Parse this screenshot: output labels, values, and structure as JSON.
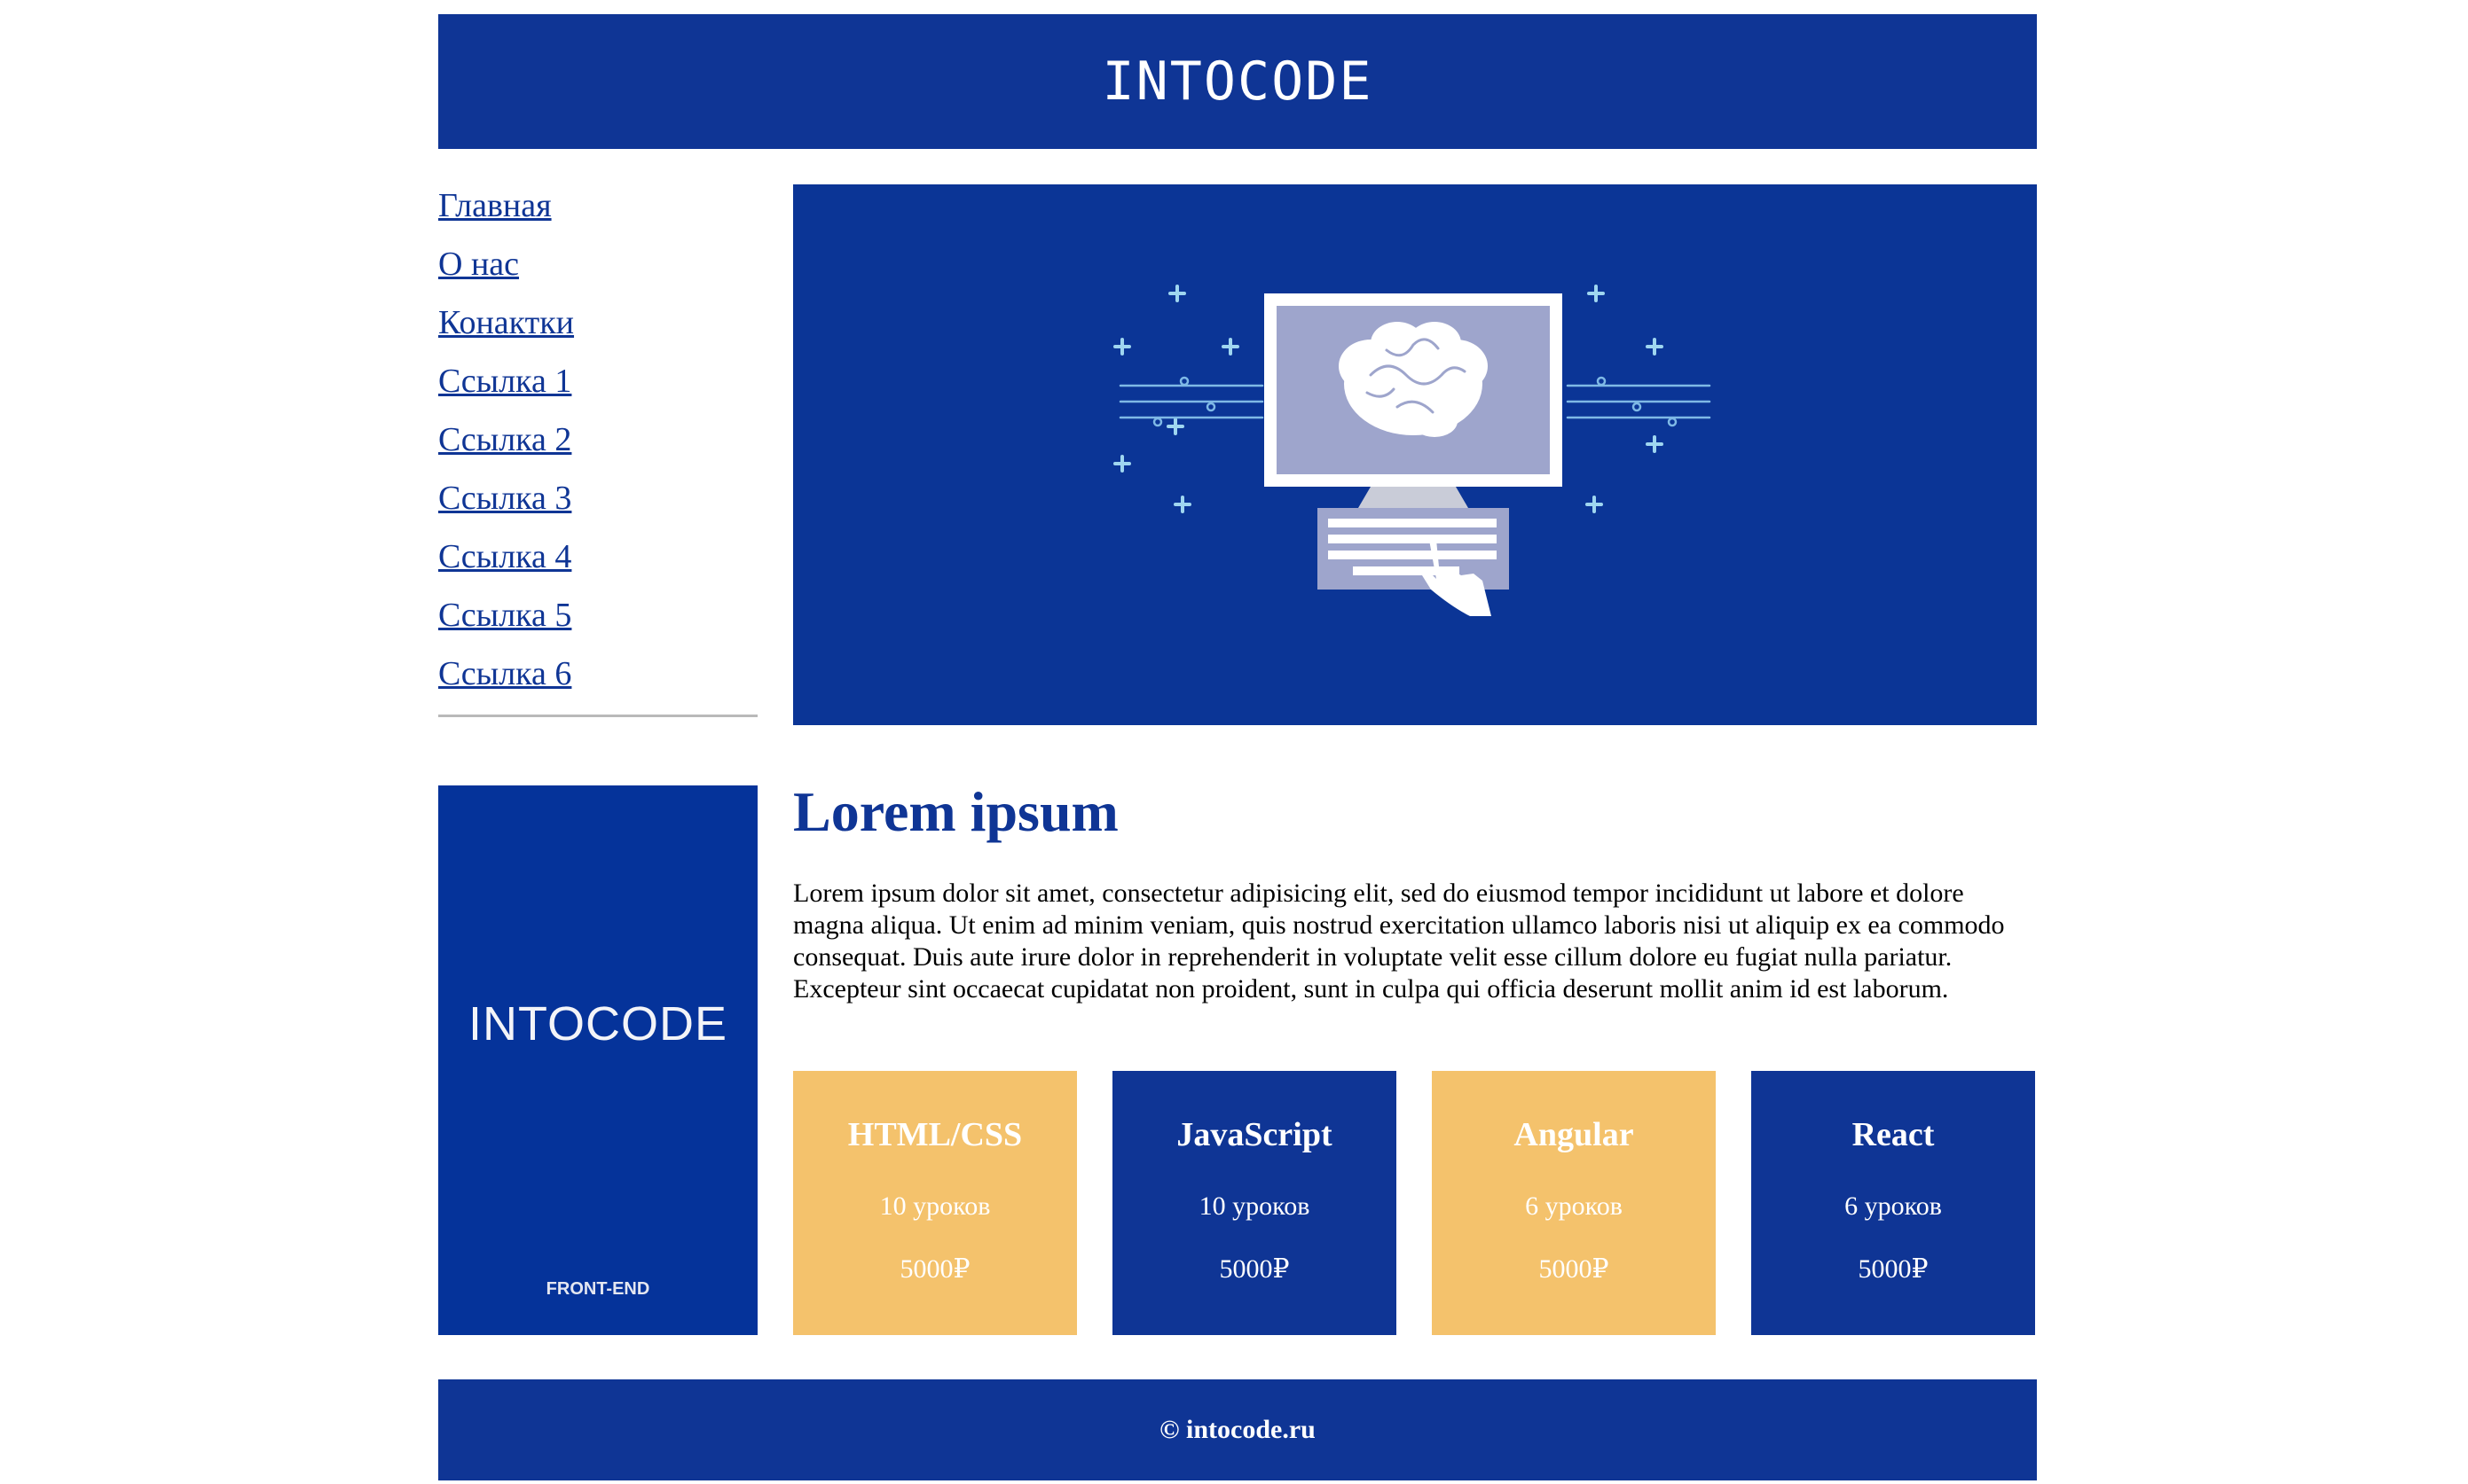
{
  "header": {
    "logo": "INTOCODE"
  },
  "nav": {
    "items": [
      {
        "label": "Главная"
      },
      {
        "label": "О нас"
      },
      {
        "label": "Конактки"
      },
      {
        "label": "Ссылка 1"
      },
      {
        "label": "Ссылка 2"
      },
      {
        "label": "Ссылка 3"
      },
      {
        "label": "Ссылка 4"
      },
      {
        "label": "Ссылка 5"
      },
      {
        "label": "Ссылка 6"
      }
    ]
  },
  "promo": {
    "brand": "INTOCODE",
    "tag": "FRONT-END"
  },
  "article": {
    "title": "Lorem ipsum",
    "text": "Lorem ipsum dolor sit amet, consectetur adipisicing elit, sed do eiusmod tempor incididunt ut labore et dolore magna aliqua. Ut enim ad minim veniam, quis nostrud exercitation ullamco laboris nisi ut aliquip ex ea commodo consequat. Duis aute irure dolor in reprehenderit in voluptate velit esse cillum dolore eu fugiat nulla pariatur. Excepteur sint occaecat cupidatat non proident, sunt in culpa qui officia deserunt mollit anim id est laborum."
  },
  "courses": [
    {
      "title": "HTML/CSS",
      "lessons": "10 уроков",
      "price": "5000₽",
      "color": "#f4c26c"
    },
    {
      "title": "JavaScript",
      "lessons": "10 уроков",
      "price": "5000₽",
      "color": "#0f3595"
    },
    {
      "title": "Angular",
      "lessons": "6 уроков",
      "price": "5000₽",
      "color": "#f4c26c"
    },
    {
      "title": "React",
      "lessons": "6 уроков",
      "price": "5000₽",
      "color": "#0f3595"
    }
  ],
  "footer": {
    "copyright": "© intocode.ru"
  },
  "colors": {
    "brand_blue": "#0f3595",
    "accent_orange": "#f4c26c",
    "divider": "#b9b9b9"
  }
}
